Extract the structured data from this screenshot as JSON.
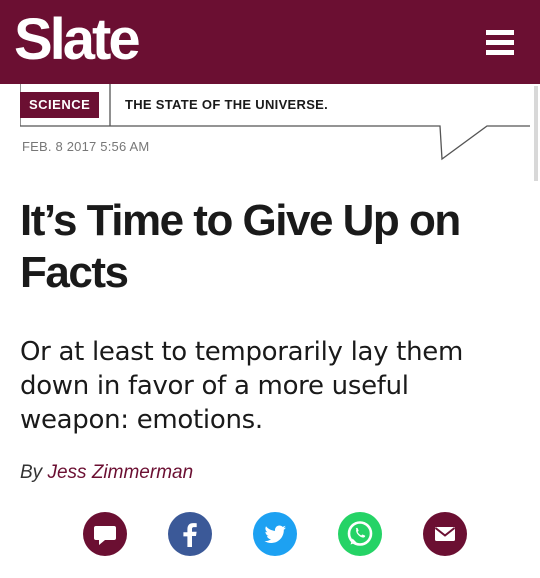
{
  "header": {
    "logo": "Slate",
    "background": "#6b0f32"
  },
  "section": {
    "tag": "SCIENCE",
    "description": "THE STATE OF THE UNIVERSE."
  },
  "article": {
    "dateline": "FEB. 8 2017 5:56 AM",
    "headline_line1": "It’s Time to Give Up on",
    "headline_line2": "Facts",
    "dek": "Or at least to temporarily lay them down in favor of a more useful weapon: emotions.",
    "byline_prefix": "By",
    "author": "Jess Zimmerman"
  },
  "share": [
    {
      "name": "comment",
      "icon": "comment-icon",
      "color": "#6b0f32"
    },
    {
      "name": "facebook",
      "icon": "facebook-icon",
      "color": "#3b5998"
    },
    {
      "name": "twitter",
      "icon": "twitter-icon",
      "color": "#1da1f2"
    },
    {
      "name": "whatsapp",
      "icon": "whatsapp-icon",
      "color": "#25d366"
    },
    {
      "name": "email",
      "icon": "email-icon",
      "color": "#6b0f32"
    }
  ]
}
